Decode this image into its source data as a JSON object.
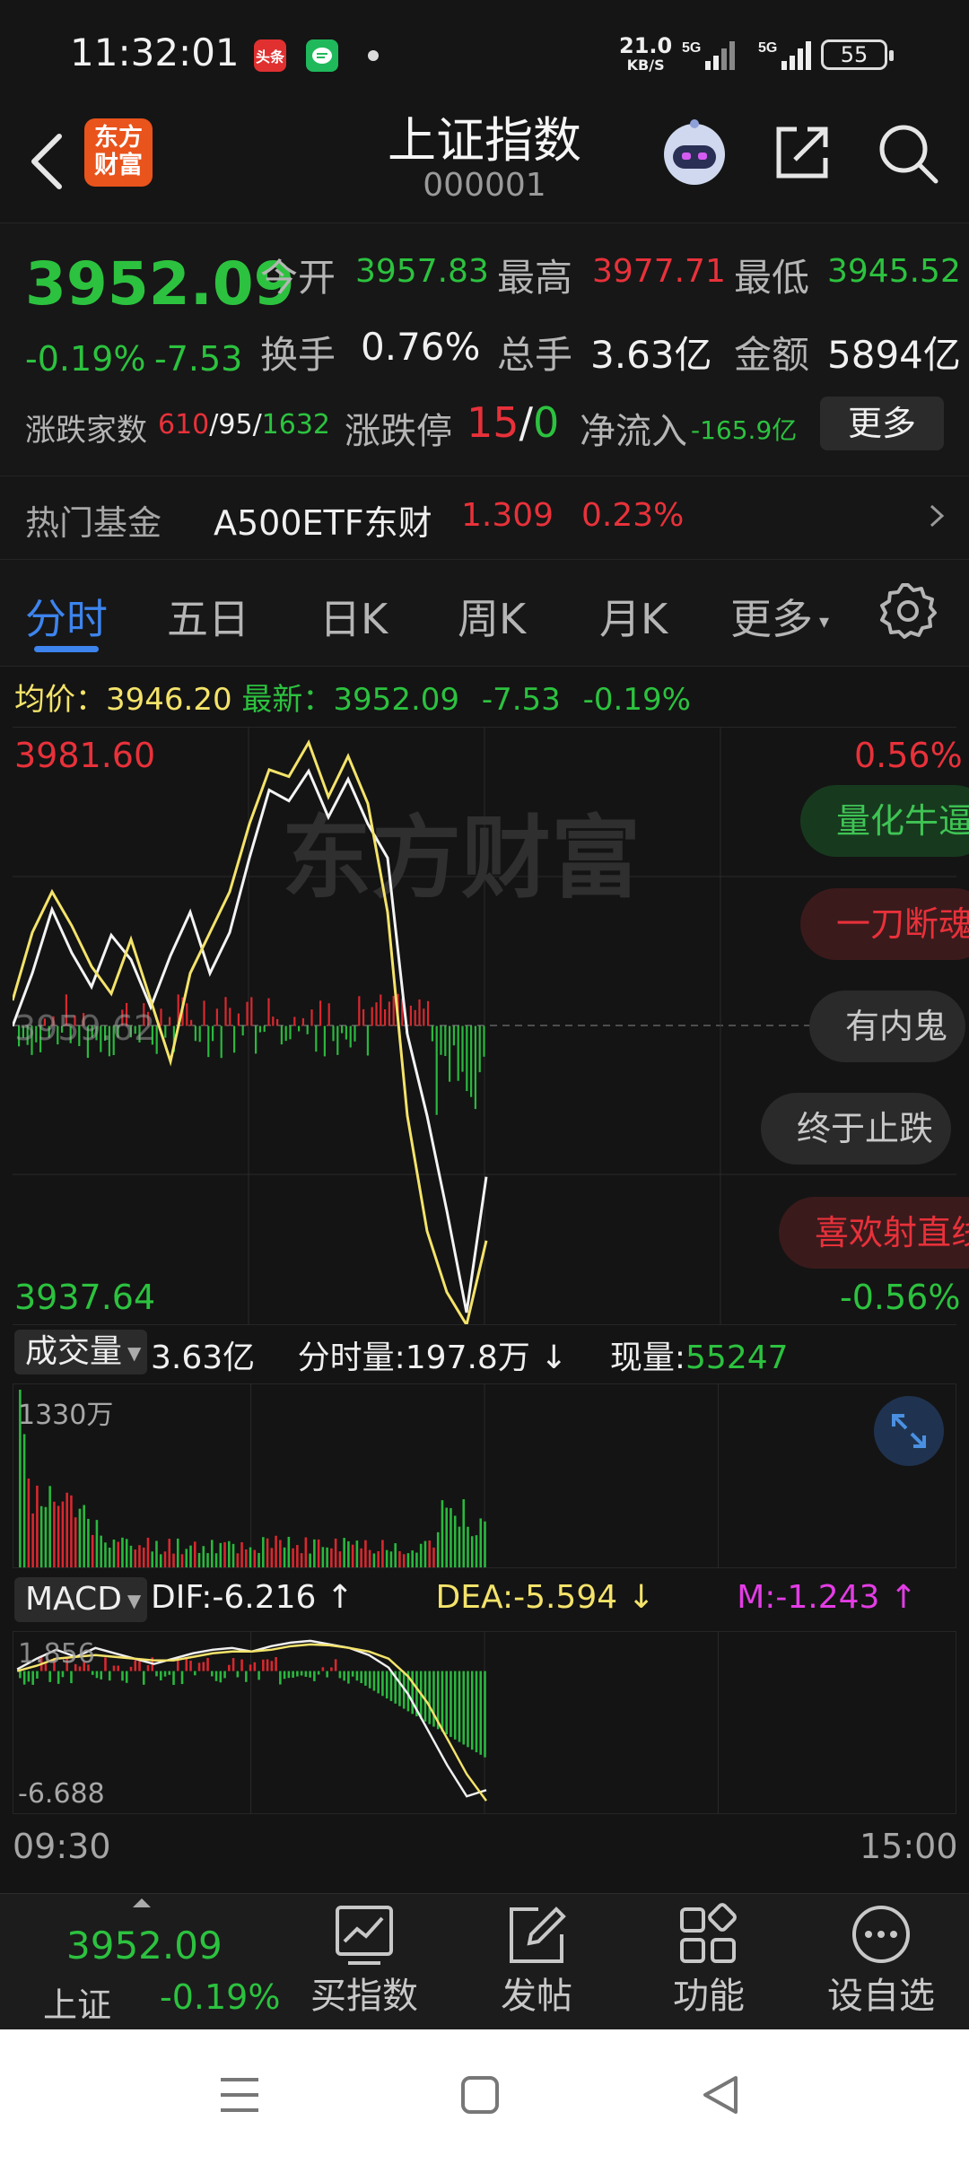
{
  "status_bar": {
    "time": "11:32:01",
    "app1": "头条",
    "net_speed": "21.0",
    "net_unit": "KB/S",
    "sig1_label": "5G",
    "sig2_label": "5G",
    "battery": "55"
  },
  "header": {
    "logo_line1": "东方",
    "logo_line2": "财富",
    "title": "上证指数",
    "code": "000001"
  },
  "quote": {
    "price": "3952.09",
    "change_pct": "-0.19%",
    "change_val": "-7.53",
    "open_label": "今开",
    "open": "3957.83",
    "high_label": "最高",
    "high": "3977.71",
    "low_label": "最低",
    "low": "3945.52",
    "turnover_label": "换手",
    "turnover": "0.76%",
    "volume_label": "总手",
    "volume": "3.63亿",
    "amount_label": "金额",
    "amount": "5894亿",
    "breadth_label": "涨跌家数",
    "breadth_up": "610",
    "breadth_flat": "95",
    "breadth_down": "1632",
    "limit_label": "涨跌停",
    "limit_up": "15",
    "limit_down": "0",
    "netflow_label": "净流入",
    "netflow": "-165.9亿",
    "more_label": "更多"
  },
  "fund": {
    "label": "热门基金",
    "name": "A500ETF东财",
    "price": "1.309",
    "pct": "0.23%"
  },
  "tabs": [
    "分时",
    "五日",
    "日K",
    "周K",
    "月K",
    "更多"
  ],
  "avg_line": {
    "avg_label": "均价：",
    "avg": "3946.20",
    "latest_label": "最新：",
    "latest": "3952.09",
    "chg": "-7.53",
    "pct": "-0.19%"
  },
  "chart": {
    "y_top": "3981.60",
    "y_bottom": "3937.64",
    "pct_top": "0.56%",
    "pct_bottom": "-0.56%",
    "prev_close_label": "3959.62",
    "watermark": "东方财富",
    "bubbles": [
      "量化牛逼",
      "一刀断魂",
      "有内鬼",
      "终于止跌",
      "喜欢射直线"
    ]
  },
  "volume": {
    "selector": "成交量",
    "total": "3.63亿",
    "minute_label": "分时量:",
    "minute": "197.8万",
    "now_label": "现量:",
    "now": "55247",
    "max_label": "1330万"
  },
  "macd": {
    "selector": "MACD",
    "dif": "DIF:-6.216",
    "dea": "DEA:-5.594",
    "m": "M:-1.243",
    "top_label": "1.856",
    "bottom_label": "-6.688"
  },
  "time_axis": {
    "start": "09:30",
    "end": "15:00"
  },
  "bottom_bar": {
    "index_price": "3952.09",
    "index_name": "上证",
    "index_pct": "-0.19%",
    "items": [
      "买指数",
      "发帖",
      "功能",
      "设自选"
    ]
  },
  "chart_data": {
    "type": "line",
    "series": [
      {
        "values": [
          3959.6,
          3963.5,
          3968.2,
          3965.0,
          3962.5,
          3966.3,
          3964.5,
          3961.0,
          3964.8,
          3968.0,
          3963.5,
          3966.5,
          3972.0,
          3977.0,
          3976.2,
          3978.4,
          3975.0,
          3977.8,
          3974.5,
          3972.0,
          3959.0,
          3953.0,
          3946.0,
          3938.5,
          3948.5
        ]
      },
      {
        "values": [
          3961.5,
          3966.5,
          3969.5,
          3967.0,
          3964.0,
          3962.0,
          3966.0,
          3961.5,
          3957.0,
          3963.5,
          3966.5,
          3969.5,
          3974.5,
          3978.5,
          3978.0,
          3980.5,
          3976.5,
          3979.5,
          3976.0,
          3968.0,
          3953.0,
          3944.5,
          3940.0,
          3937.6,
          3943.8
        ]
      }
    ],
    "ylim": [
      3937.64,
      3981.6
    ],
    "prev_close": 3959.62,
    "grid": true
  }
}
